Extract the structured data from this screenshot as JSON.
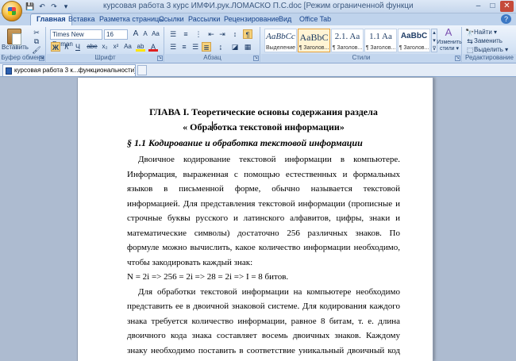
{
  "window": {
    "title": "курсовая работа 3 курс ИМФИ.рук.ЛОМАСКО П.С.doc [Режим ограниченной функциональности] - Microsoft Word",
    "minimize": "–",
    "maximize": "□",
    "close": "✕"
  },
  "qat": {
    "save": "💾",
    "undo": "↶",
    "redo": "↷",
    "more": "▾"
  },
  "tabs": [
    "Главная",
    "Вставка",
    "Разметка страницы",
    "Ссылки",
    "Рассылки",
    "Рецензирование",
    "Вид",
    "Office Tab"
  ],
  "active_tab": "Главная",
  "help": "?",
  "ribbon": {
    "clipboard": {
      "label": "Буфер обмена",
      "paste": "Вставить"
    },
    "font": {
      "label": "Шрифт",
      "font_name": "Times New Roman",
      "font_size": "16",
      "grow": "A",
      "shrink": "A",
      "clear": "Aa",
      "bold": "Ж",
      "italic": "К",
      "underline": "Ч",
      "strike": "abe",
      "subscript": "x₂",
      "superscript": "x²",
      "change_case": "Aa",
      "highlight": "ab",
      "font_color": "A"
    },
    "paragraph": {
      "label": "Абзац",
      "pilcrow": "¶"
    },
    "styles": {
      "label": "Стили",
      "items": [
        {
          "sample": "AaBbCc",
          "name": "Выделение"
        },
        {
          "sample": "AaBbC",
          "name": "¶ Заголов..."
        },
        {
          "sample": "2.1. Aa",
          "name": "¶ Заголов..."
        },
        {
          "sample": "1.1 Aa",
          "name": "¶ Заголов..."
        },
        {
          "sample": "AaBbC",
          "name": "¶ Заголов..."
        }
      ],
      "change_styles_line1": "Изменить",
      "change_styles_line2": "стили ▾"
    },
    "editing": {
      "label": "Редактирование",
      "find": "Найти ▾",
      "replace": "Заменить",
      "select": "Выделить ▾"
    }
  },
  "doc_tab": {
    "label": "курсовая работа 3 к...функциональности] *"
  },
  "document": {
    "heading1": "ГЛАВА I. Теоретические основы содержания раздела",
    "heading2_before": "« Обра",
    "heading2_after": "ботка текстовой информации»",
    "section": "§ 1.1 Кодирование и обработка текстовой информации",
    "para1": "Двоичное кодирование текстовой информации в компьютере. Информация, выраженная с помощью естественных и формальных языков в письменной форме, обычно называется текстовой информацией. Для представления текстовой информации (прописные и строчные буквы русского и латинского алфавитов, цифры, знаки и математические символы) достаточно 256 различных знаков. По формуле можно вычислить, какое количество информации необходимо, чтобы закодировать каждый знак:",
    "formula": "N = 2i => 256 = 2i => 28 = 2i => I = 8 битов.",
    "para2": "Для обработки текстовой информации на компьютере необходимо представить ее в двоичной знаковой системе. Для кодирования каждого знака требуется количество информации, равное 8 битам, т. е. длина двоичного кода знака составляет восемь двоичных знаков. Каждому знаку необходимо поставить в соответствие уникальный двоичный код из"
  }
}
